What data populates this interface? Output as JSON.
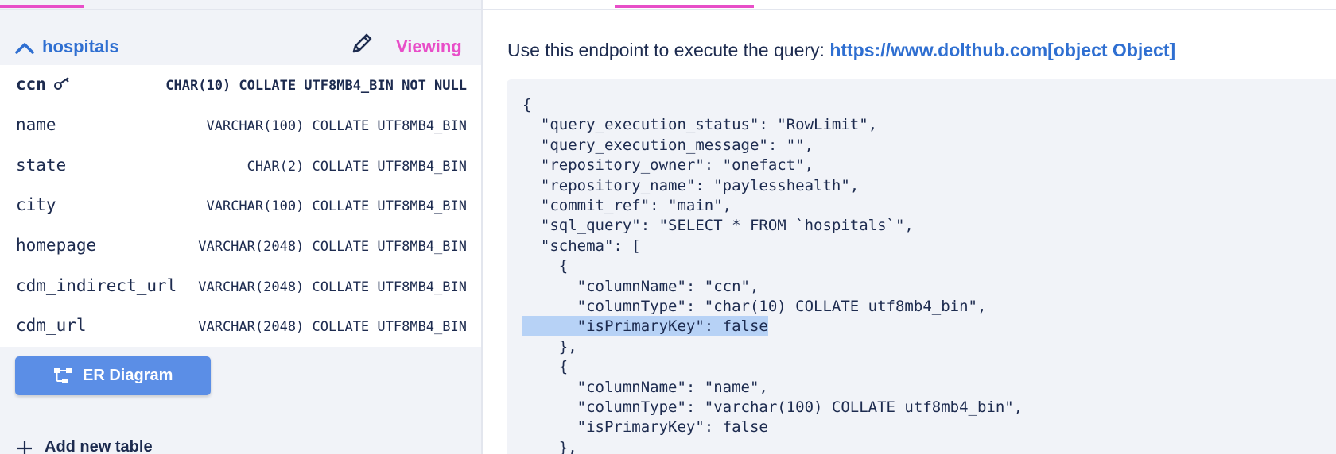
{
  "colors": {
    "accent_pink": "#e84ec8",
    "link_blue": "#2f6fd1",
    "button_blue": "#5b8ee6",
    "text_navy": "#1d2b4f",
    "panel_gray": "#f1f3f8",
    "selection_blue": "#b7d2f6"
  },
  "sidebar": {
    "table_name": "hospitals",
    "collapse_icon": "chevron-up-icon",
    "edit_icon": "pencil-icon",
    "mode_label": "Viewing",
    "columns": [
      {
        "name": "ccn",
        "type": "CHAR(10) COLLATE UTF8MB4_BIN NOT NULL",
        "primary_key": true,
        "key_icon": "key-icon"
      },
      {
        "name": "name",
        "type": "VARCHAR(100) COLLATE UTF8MB4_BIN",
        "primary_key": false
      },
      {
        "name": "state",
        "type": "CHAR(2) COLLATE UTF8MB4_BIN",
        "primary_key": false
      },
      {
        "name": "city",
        "type": "VARCHAR(100) COLLATE UTF8MB4_BIN",
        "primary_key": false
      },
      {
        "name": "homepage",
        "type": "VARCHAR(2048) COLLATE UTF8MB4_BIN",
        "primary_key": false
      },
      {
        "name": "cdm_indirect_url",
        "type": "VARCHAR(2048) COLLATE UTF8MB4_BIN",
        "primary_key": false
      },
      {
        "name": "cdm_url",
        "type": "VARCHAR(2048) COLLATE UTF8MB4_BIN",
        "primary_key": false
      }
    ],
    "er_button": {
      "label": "ER Diagram",
      "icon": "diagram-icon"
    },
    "add_table": {
      "label": "Add new table",
      "icon": "plus-icon"
    }
  },
  "main": {
    "endpoint_text": "Use this endpoint to execute the query: ",
    "endpoint_link": "https://www.dolthub.com[object Object]",
    "code_lines": [
      "{",
      "  \"query_execution_status\": \"RowLimit\",",
      "  \"query_execution_message\": \"\",",
      "  \"repository_owner\": \"onefact\",",
      "  \"repository_name\": \"paylesshealth\",",
      "  \"commit_ref\": \"main\",",
      "  \"sql_query\": \"SELECT * FROM `hospitals`\",",
      "  \"schema\": [",
      "    {",
      "      \"columnName\": \"ccn\",",
      "      \"columnType\": \"char(10) COLLATE utf8mb4_bin\",",
      "      \"isPrimaryKey\": false",
      "    },",
      "    {",
      "      \"columnName\": \"name\",",
      "      \"columnType\": \"varchar(100) COLLATE utf8mb4_bin\",",
      "      \"isPrimaryKey\": false",
      "    },"
    ],
    "selected_line_index": 11
  }
}
